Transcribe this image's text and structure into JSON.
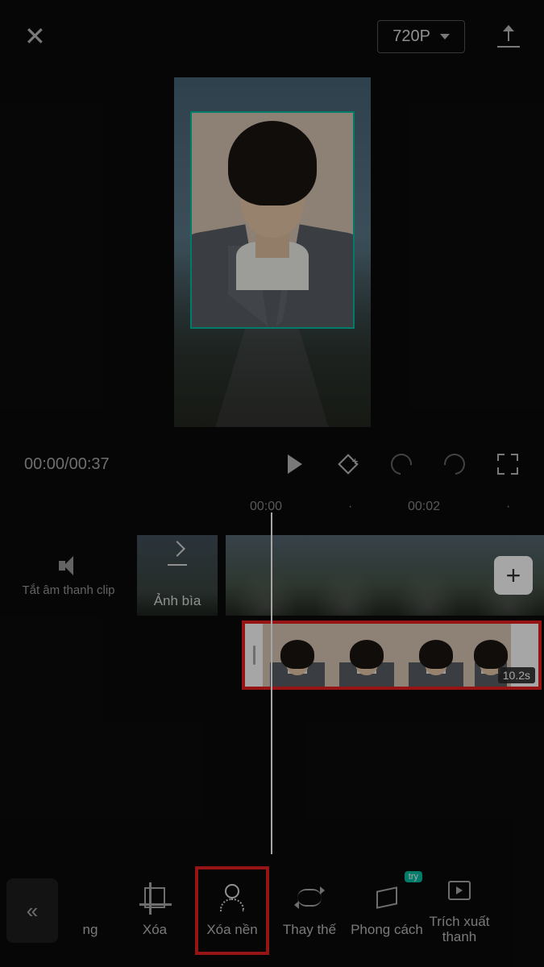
{
  "top": {
    "resolution": "720P"
  },
  "playback": {
    "time_display": "00:00/00:37"
  },
  "ruler": {
    "t0": "00:00",
    "t1": "00:02"
  },
  "sideTool": {
    "mute_label": "Tắt âm thanh clip"
  },
  "cover": {
    "label": "Ảnh bìa"
  },
  "overlayClip": {
    "duration_label": "10.2s"
  },
  "toolbar": {
    "item0_partial": "ng",
    "crop": "Xóa",
    "remove_bg": "Xóa nền",
    "replace": "Thay thế",
    "style": "Phong cách",
    "style_badge": "try",
    "extract": "Trích xuất thanh"
  }
}
